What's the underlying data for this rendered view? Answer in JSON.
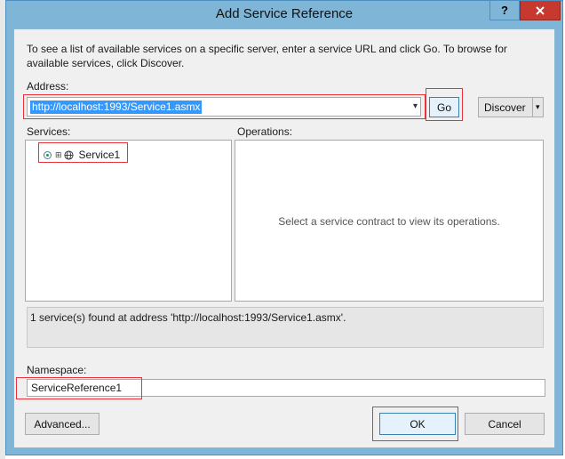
{
  "window": {
    "title": "Add Service Reference",
    "help_label": "?",
    "close_label": "x"
  },
  "description": "To see a list of available services on a specific server, enter a service URL and click Go. To browse for available services, click Discover.",
  "address": {
    "label": "Address:",
    "value": "http://localhost:1993/Service1.asmx",
    "go_label": "Go",
    "discover_label": "Discover",
    "dropdown_glyph": "▾"
  },
  "services": {
    "label": "Services:",
    "items": [
      {
        "label": "Service1",
        "expander": "⊞",
        "icon": "globe-icon"
      }
    ]
  },
  "operations": {
    "label": "Operations:",
    "empty_text": "Select a service contract to view its operations."
  },
  "status": {
    "text": "1 service(s) found at address 'http://localhost:1993/Service1.asmx'."
  },
  "namespace": {
    "label": "Namespace:",
    "value": "ServiceReference1"
  },
  "footer": {
    "advanced_label": "Advanced...",
    "ok_label": "OK",
    "cancel_label": "Cancel"
  },
  "colors": {
    "title_bar": "#7fb6d8",
    "close_button": "#c7382f",
    "selection": "#3399ff",
    "annotation_highlight": "#e8323c"
  }
}
